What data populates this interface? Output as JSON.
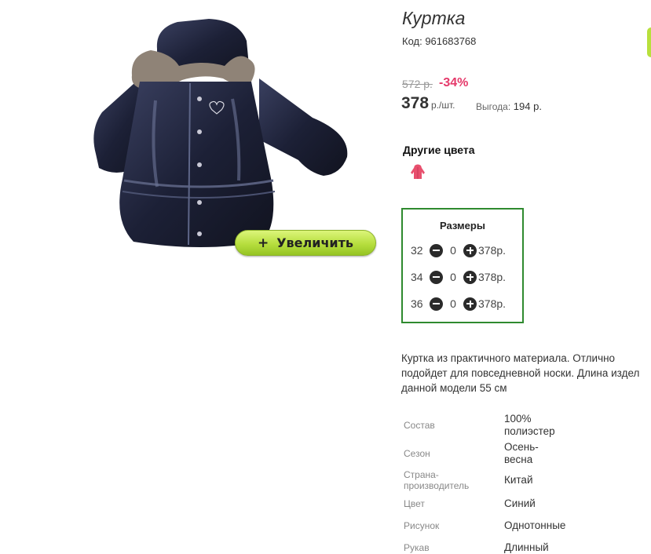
{
  "product": {
    "title": "Куртка",
    "code": "Код: 961683768"
  },
  "price": {
    "old": "572 р.",
    "discount": "-34%",
    "current": "378",
    "unit": "р./шт.",
    "savings_label": "Выгода:",
    "savings_value": "194 р."
  },
  "zoom_button": {
    "icon": "plus-icon",
    "label": "Увеличить"
  },
  "other_colors": {
    "title": "Другие цвета",
    "swatches": [
      {
        "icon": "pink-jacket-thumbnail",
        "color": "#e8506e"
      }
    ]
  },
  "sizes": {
    "title": "Размеры",
    "rows": [
      {
        "size": "32",
        "qty": "0",
        "price": "378р."
      },
      {
        "size": "34",
        "qty": "0",
        "price": "378р."
      },
      {
        "size": "36",
        "qty": "0",
        "price": "378р."
      }
    ]
  },
  "description": {
    "lines": [
      "Куртка из практичного материала. Отлично",
      "подойдет для повседневной носки. Длина издел",
      "данной модели 55 см"
    ]
  },
  "specs": [
    {
      "label": "Состав",
      "value": "100% полиэстер"
    },
    {
      "label": "Сезон",
      "value": "Осень-весна"
    },
    {
      "label": "Страна-производитель",
      "value": "Китай"
    },
    {
      "label": "Цвет",
      "value": "Синий"
    },
    {
      "label": "Рисунок",
      "value": "Однотонные"
    },
    {
      "label": "Рукав",
      "value": "Длинный"
    }
  ],
  "colors": {
    "accent_green": "#b6de3e",
    "box_border": "#2f8a2f",
    "discount_pink": "#e5396a",
    "jacket_navy": "#1e2238"
  }
}
